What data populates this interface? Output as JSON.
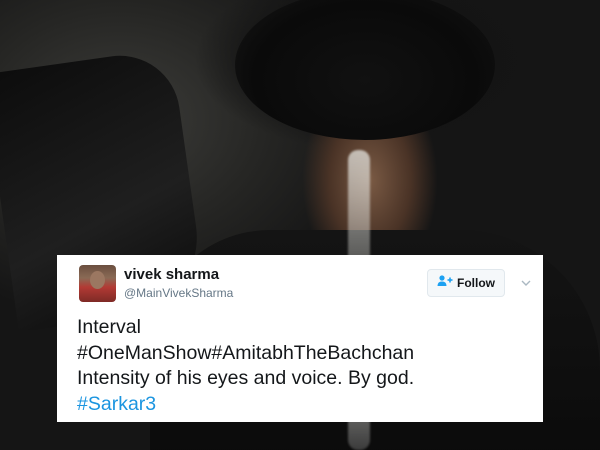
{
  "background_photo": {
    "icon": "photo-background"
  },
  "tweet": {
    "avatar_icon": "user-avatar",
    "display_name": "vivek sharma",
    "handle": "@MainVivekSharma",
    "follow_label": "Follow",
    "follow_icon": "add-user-icon",
    "menu_icon": "chevron-down-icon",
    "text_lines": [
      "Interval",
      "#OneManShow#AmitabhTheBachchan",
      "Intensity of his eyes and voice. By god.",
      "#Sarkar3"
    ],
    "colors": {
      "text": "#14171a",
      "secondary": "#657786",
      "link": "#1b95e0",
      "follow_icon": "#1da1f2"
    }
  }
}
